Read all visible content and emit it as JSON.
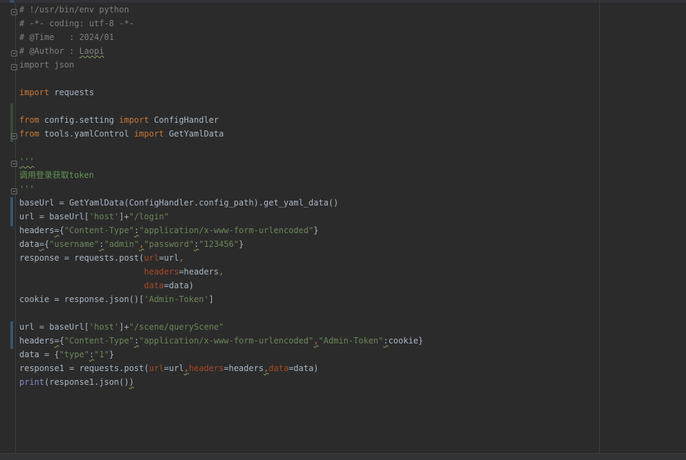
{
  "editor": {
    "language": "python",
    "colors": {
      "background": "#2b2b2b",
      "comment": "#808080",
      "keyword": "#cc7832",
      "string": "#6a8759",
      "param": "#aa4926",
      "builtin": "#8888c6",
      "plain": "#a9b7c6"
    },
    "lines": [
      [
        {
          "t": "# !/usr/bin/env python",
          "c": "comment"
        }
      ],
      [
        {
          "t": "# -*- coding: utf-8 -*-",
          "c": "comment"
        }
      ],
      [
        {
          "t": "# @Time   : 2024/01",
          "c": "comment"
        }
      ],
      [
        {
          "t": "# @Author : ",
          "c": "comment"
        },
        {
          "t": "Laopi",
          "c": "comment",
          "w": true
        }
      ],
      [
        {
          "t": "import",
          "c": "comment"
        },
        {
          "t": " json",
          "c": "comment"
        }
      ],
      [],
      [
        {
          "t": "import",
          "c": "keyword"
        },
        {
          "t": " requests",
          "c": "plain"
        }
      ],
      [],
      [
        {
          "t": "from",
          "c": "keyword"
        },
        {
          "t": " config.setting ",
          "c": "plain"
        },
        {
          "t": "import",
          "c": "keyword"
        },
        {
          "t": " ConfigHandler",
          "c": "plain"
        }
      ],
      [
        {
          "t": "from",
          "c": "keyword"
        },
        {
          "t": " tools.yamlControl ",
          "c": "plain"
        },
        {
          "t": "import",
          "c": "keyword"
        },
        {
          "t": " GetYamlData",
          "c": "plain"
        }
      ],
      [],
      [
        {
          "t": "'''",
          "c": "doc",
          "w": true
        }
      ],
      [
        {
          "t": "调用登录获取token",
          "c": "doc"
        }
      ],
      [
        {
          "t": "'''",
          "c": "doc"
        }
      ],
      [
        {
          "t": "baseUrl = GetYamlData(ConfigHandler.config_path).get_yaml_data()",
          "c": "plain"
        }
      ],
      [
        {
          "t": "url = baseUrl[",
          "c": "plain"
        },
        {
          "t": "'host'",
          "c": "string"
        },
        {
          "t": "]+",
          "c": "plain"
        },
        {
          "t": "\"/login\"",
          "c": "string"
        }
      ],
      [
        {
          "t": "headers",
          "c": "plain"
        },
        {
          "t": "=",
          "c": "plain",
          "w": true
        },
        {
          "t": "{",
          "c": "plain"
        },
        {
          "t": "\"Content-Type\"",
          "c": "string"
        },
        {
          "t": ":",
          "c": "plain",
          "w": true
        },
        {
          "t": "\"application/x-www-form-urlencoded\"",
          "c": "string"
        },
        {
          "t": "}",
          "c": "plain"
        }
      ],
      [
        {
          "t": "data",
          "c": "plain"
        },
        {
          "t": "=",
          "c": "plain",
          "w": true
        },
        {
          "t": "{",
          "c": "plain"
        },
        {
          "t": "\"username\"",
          "c": "string"
        },
        {
          "t": ":",
          "c": "plain",
          "w": true
        },
        {
          "t": "\"admin\"",
          "c": "string"
        },
        {
          "t": ",",
          "c": "keyword",
          "w": true
        },
        {
          "t": "\"password\"",
          "c": "string"
        },
        {
          "t": ":",
          "c": "plain",
          "w": true
        },
        {
          "t": "\"123456\"",
          "c": "string"
        },
        {
          "t": "}",
          "c": "plain"
        }
      ],
      [
        {
          "t": "response = requests.post(",
          "c": "plain"
        },
        {
          "t": "url",
          "c": "param"
        },
        {
          "t": "=url",
          "c": "plain"
        },
        {
          "t": ",",
          "c": "keyword"
        }
      ],
      [
        {
          "t": "                         ",
          "c": "plain"
        },
        {
          "t": "headers",
          "c": "param"
        },
        {
          "t": "=headers",
          "c": "plain"
        },
        {
          "t": ",",
          "c": "keyword"
        }
      ],
      [
        {
          "t": "                         ",
          "c": "plain"
        },
        {
          "t": "data",
          "c": "param"
        },
        {
          "t": "=data)",
          "c": "plain"
        }
      ],
      [
        {
          "t": "cookie = response.json()[",
          "c": "plain"
        },
        {
          "t": "'Admin-Token'",
          "c": "string"
        },
        {
          "t": "]",
          "c": "plain"
        }
      ],
      [],
      [
        {
          "t": "url = baseUrl[",
          "c": "plain"
        },
        {
          "t": "'host'",
          "c": "string"
        },
        {
          "t": "]+",
          "c": "plain"
        },
        {
          "t": "\"/scene/queryScene\"",
          "c": "string"
        }
      ],
      [
        {
          "t": "headers",
          "c": "plain"
        },
        {
          "t": "=",
          "c": "plain",
          "w": true
        },
        {
          "t": "{",
          "c": "plain"
        },
        {
          "t": "\"Content-Type\"",
          "c": "string"
        },
        {
          "t": ":",
          "c": "plain",
          "w": true
        },
        {
          "t": "\"application/x-www-form-urlencoded\"",
          "c": "string"
        },
        {
          "t": ",",
          "c": "keyword",
          "w": true
        },
        {
          "t": "\"Admin-Token\"",
          "c": "string"
        },
        {
          "t": ":",
          "c": "plain",
          "w": true
        },
        {
          "t": "cookie}",
          "c": "plain"
        }
      ],
      [
        {
          "t": "data = {",
          "c": "plain"
        },
        {
          "t": "\"type\"",
          "c": "string"
        },
        {
          "t": ":",
          "c": "plain",
          "w": true
        },
        {
          "t": "\"1\"",
          "c": "string"
        },
        {
          "t": "}",
          "c": "plain"
        }
      ],
      [
        {
          "t": "response1 = requests.post(",
          "c": "plain"
        },
        {
          "t": "url",
          "c": "param"
        },
        {
          "t": "=url",
          "c": "plain"
        },
        {
          "t": ",",
          "c": "keyword",
          "w": true
        },
        {
          "t": "headers",
          "c": "param"
        },
        {
          "t": "=headers",
          "c": "plain"
        },
        {
          "t": ",",
          "c": "keyword",
          "w": true
        },
        {
          "t": "data",
          "c": "param"
        },
        {
          "t": "=data)",
          "c": "plain"
        }
      ],
      [
        {
          "t": "print",
          "c": "builtin"
        },
        {
          "t": "(response1.json()",
          "c": "plain"
        },
        {
          "t": ")",
          "c": "plain",
          "w": true
        }
      ]
    ]
  }
}
